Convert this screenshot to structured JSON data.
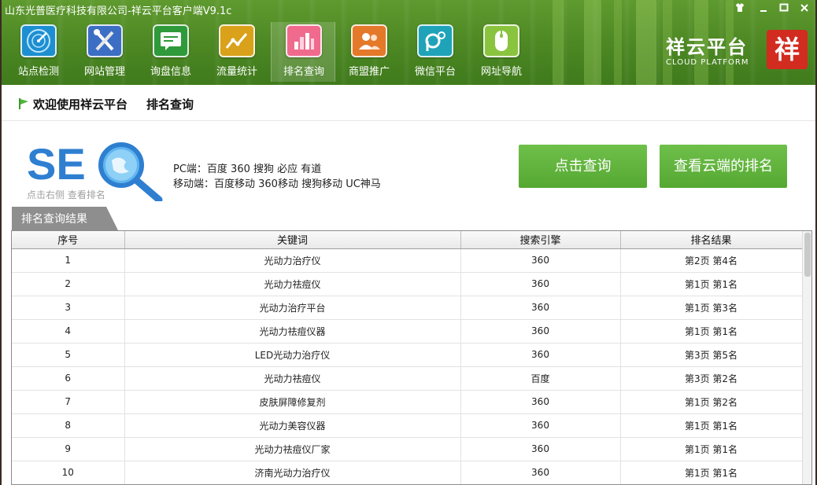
{
  "window": {
    "title": "山东光普医疗科技有限公司-祥云平台客户端V9.1c"
  },
  "toolbar": {
    "items": [
      {
        "label": "站点检测",
        "icon": "radar-icon"
      },
      {
        "label": "网站管理",
        "icon": "tools-icon"
      },
      {
        "label": "询盘信息",
        "icon": "message-icon"
      },
      {
        "label": "流量统计",
        "icon": "trend-chart-icon"
      },
      {
        "label": "排名查询",
        "icon": "bar-chart-icon",
        "active": true
      },
      {
        "label": "商盟推广",
        "icon": "users-icon"
      },
      {
        "label": "微信平台",
        "icon": "wechat-icon"
      },
      {
        "label": "网址导航",
        "icon": "mouse-icon"
      }
    ]
  },
  "logo": {
    "text": "祥云平台",
    "subtitle": "CLOUD PLATFORM",
    "seal": "祥"
  },
  "breadcrumb": {
    "welcome": "欢迎使用祥云平台",
    "current": "排名查询"
  },
  "seo": {
    "hint": "点击右侧 查看排名",
    "pc_line": "PC端：百度 360 搜狗 必应 有道",
    "mobile_line": "移动端：百度移动 360移动 搜狗移动 UC神马",
    "query_button": "点击查询",
    "cloud_button": "查看云端的排名"
  },
  "results": {
    "tab_label": "排名查询结果",
    "columns": [
      "序号",
      "关键词",
      "搜索引擎",
      "排名结果"
    ],
    "rows": [
      [
        "1",
        "光动力治疗仪",
        "360",
        "第2页 第4名"
      ],
      [
        "2",
        "光动力祛痘仪",
        "360",
        "第1页 第1名"
      ],
      [
        "3",
        "光动力治疗平台",
        "360",
        "第1页 第3名"
      ],
      [
        "4",
        "光动力祛痘仪器",
        "360",
        "第1页 第1名"
      ],
      [
        "5",
        "LED光动力治疗仪",
        "360",
        "第3页 第5名"
      ],
      [
        "6",
        "光动力祛痘仪",
        "百度",
        "第3页 第2名"
      ],
      [
        "7",
        "皮肤屏障修复剂",
        "360",
        "第1页 第2名"
      ],
      [
        "8",
        "光动力美容仪器",
        "360",
        "第1页 第1名"
      ],
      [
        "9",
        "光动力祛痘仪厂家",
        "360",
        "第1页 第1名"
      ],
      [
        "10",
        "济南光动力治疗仪",
        "360",
        "第1页 第1名"
      ]
    ]
  },
  "colors": {
    "header_green": "#4f8a25",
    "button_green": "#5cb037",
    "tab_gray": "#8e8e8e",
    "seal_red": "#d22b1f"
  }
}
